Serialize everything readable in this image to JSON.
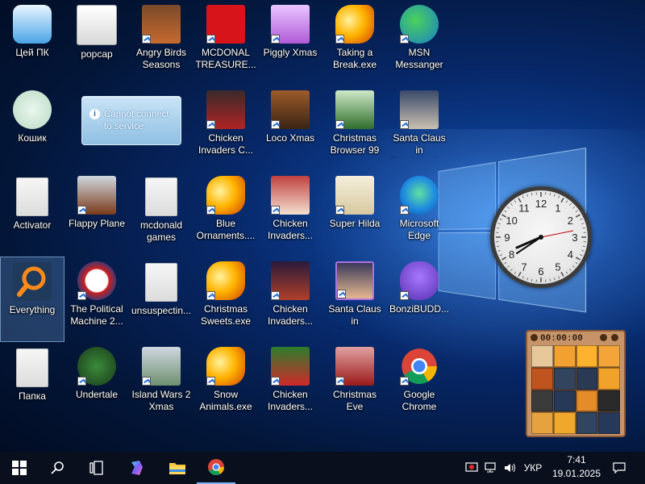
{
  "desktop": {
    "icons": [
      {
        "label": "Цей ПК"
      },
      {
        "label": "popcap"
      },
      {
        "label": "Angry Birds\nSeasons"
      },
      {
        "label": "MCDONAL\nTREASURE..."
      },
      {
        "label": "Piggly Xmas"
      },
      {
        "label": "Taking a\nBreak.exe"
      },
      {
        "label": "MSN\nMessanger"
      },
      {
        "label": "Кошик"
      },
      {
        "label": "Chicken\nInvaders C..."
      },
      {
        "label": "Loco Xmas"
      },
      {
        "label": "Christmas\nBrowser 99"
      },
      {
        "label": "Santa Claus in\nTrouble... A..."
      },
      {
        "label": "Activator"
      },
      {
        "label": "Flappy Plane"
      },
      {
        "label": "mcdonald\ngames"
      },
      {
        "label": "Blue\nOrnaments...."
      },
      {
        "label": "Chicken\nInvaders..."
      },
      {
        "label": "Super Hilda"
      },
      {
        "label": "Microsoft\nEdge"
      },
      {
        "label": "Everything"
      },
      {
        "label": "The Political\nMachine 2..."
      },
      {
        "label": "unsuspectin..."
      },
      {
        "label": "Christmas\nSweets.exe"
      },
      {
        "label": "Chicken\nInvaders..."
      },
      {
        "label": "Santa Claus in\nTrouble"
      },
      {
        "label": "BonziBUDD..."
      },
      {
        "label": "Папка"
      },
      {
        "label": "Undertale"
      },
      {
        "label": "Island Wars 2\nXmas"
      },
      {
        "label": "Snow\nAnimals.exe"
      },
      {
        "label": "Chicken\nInvaders..."
      },
      {
        "label": "Christmas Eve\nCrisis"
      },
      {
        "label": "Google\nChrome"
      }
    ],
    "notification": {
      "text": "Cannot connect\nto service"
    }
  },
  "gadgets": {
    "clock": {
      "numerals": [
        "12",
        "1",
        "2",
        "3",
        "4",
        "5",
        "6",
        "7",
        "8",
        "9",
        "10",
        "11"
      ],
      "time": "7:41"
    },
    "puzzle": {
      "timer": "00:00:00"
    }
  },
  "taskbar": {
    "search_icon": "search-icon",
    "tray": {
      "language": "УКР",
      "time": "7:41",
      "date": "19.01.2025"
    }
  },
  "colors": {
    "accent": "#2a6fd6",
    "taskbar": "#0a0f1d"
  }
}
